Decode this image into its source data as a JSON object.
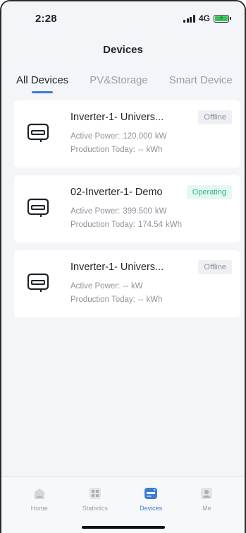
{
  "status_bar": {
    "time": "2:28",
    "network": "4G"
  },
  "header": {
    "title": "Devices"
  },
  "tabs": [
    {
      "label": "All Devices",
      "active": true
    },
    {
      "label": "PV&Storage",
      "active": false
    },
    {
      "label": "Smart Device",
      "active": false
    }
  ],
  "devices": [
    {
      "name": "Inverter-1- Univers...",
      "status": "Offline",
      "active_power_label": "Active Power:",
      "active_power": "120.000",
      "active_power_unit": "kW",
      "production_label": "Production Today:",
      "production": "--",
      "production_unit": "kWh"
    },
    {
      "name": "02-Inverter-1- Demo",
      "status": "Operating",
      "active_power_label": "Active Power:",
      "active_power": "399.500",
      "active_power_unit": "kW",
      "production_label": "Production Today:",
      "production": "174.54",
      "production_unit": "kWh"
    },
    {
      "name": "Inverter-1- Univers...",
      "status": "Offline",
      "active_power_label": "Active Power:",
      "active_power": "--",
      "active_power_unit": "kW",
      "production_label": "Production Today:",
      "production": "--",
      "production_unit": "kWh"
    }
  ],
  "tabbar": [
    {
      "label": "Home",
      "icon": "home-icon",
      "active": false
    },
    {
      "label": "Statistics",
      "icon": "statistics-icon",
      "active": false
    },
    {
      "label": "Devices",
      "icon": "devices-icon",
      "active": true
    },
    {
      "label": "Me",
      "icon": "profile-icon",
      "active": false
    }
  ],
  "colors": {
    "accent": "#3b7bd4",
    "operating": "#2ab38a",
    "offline": "#8d939b",
    "battery": "#33c25a"
  }
}
